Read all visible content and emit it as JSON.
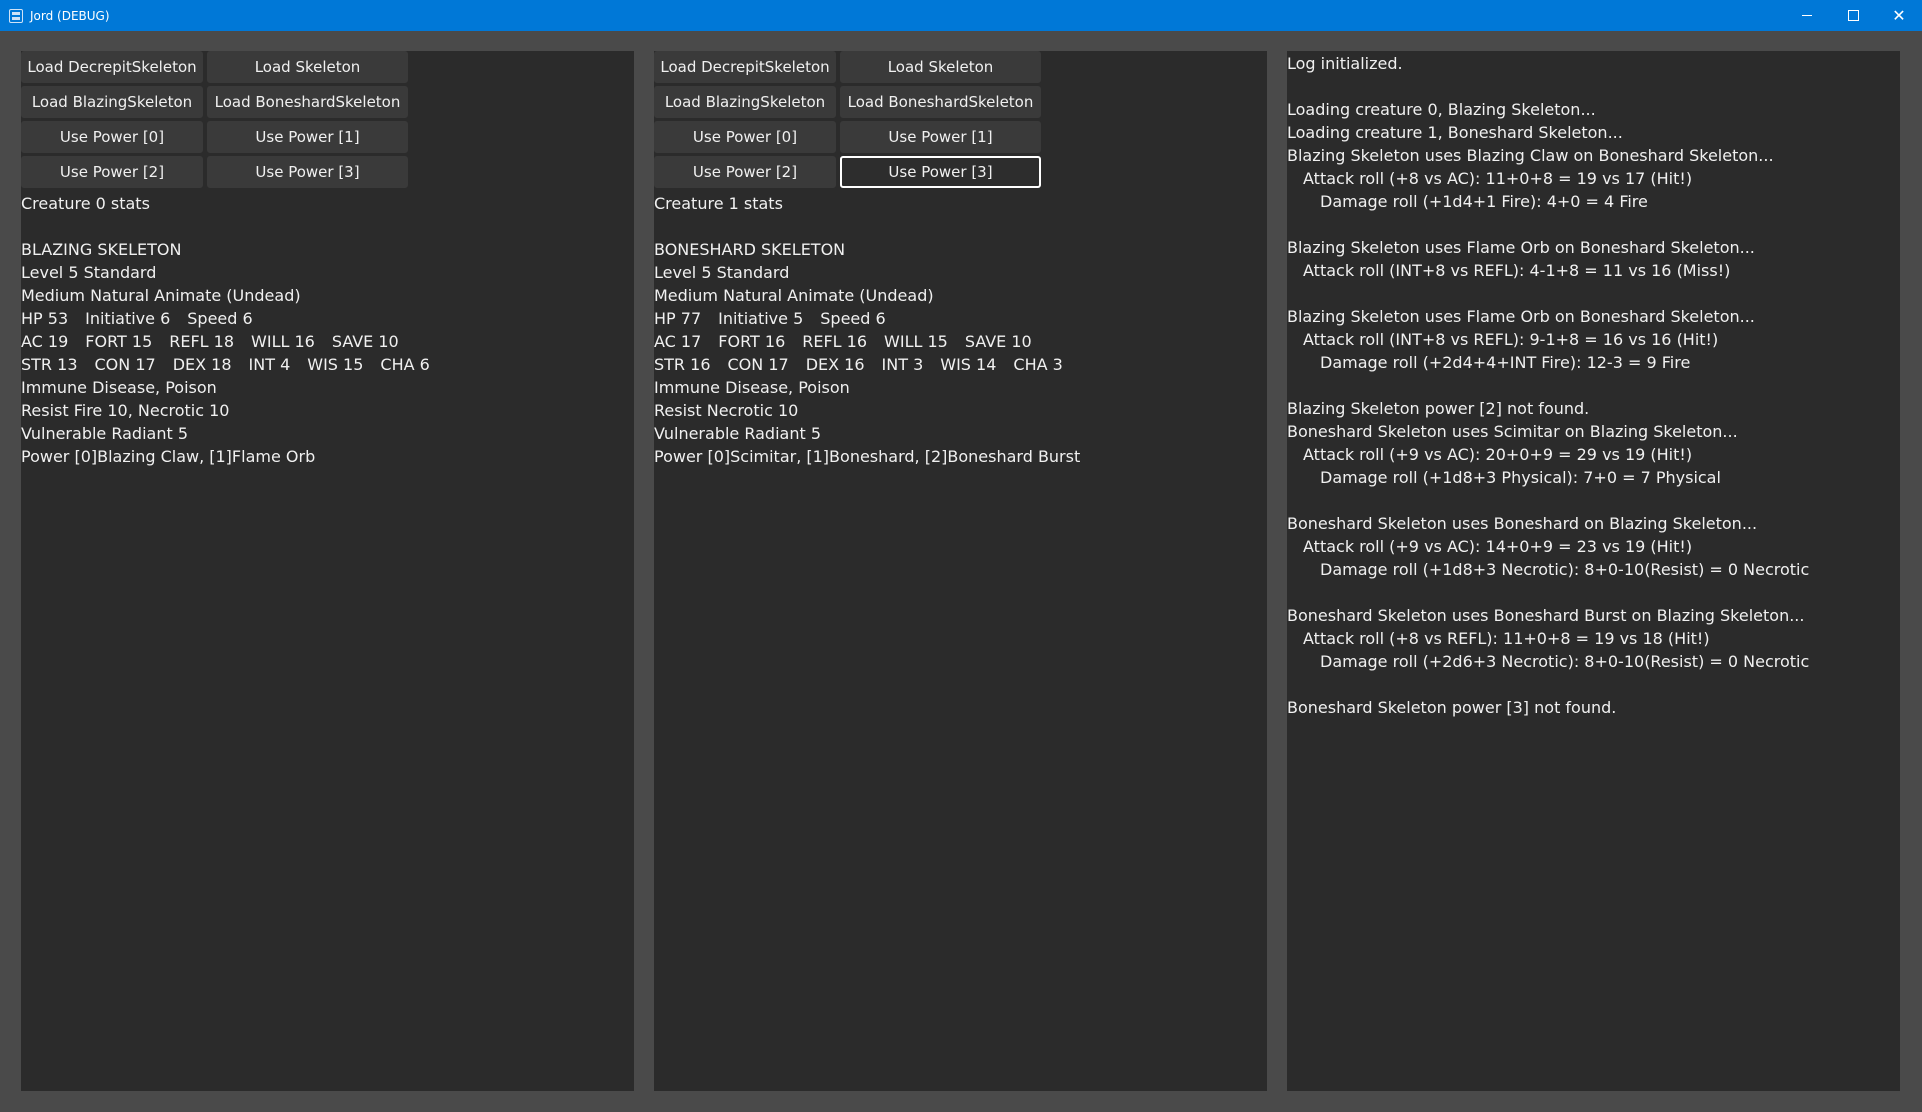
{
  "window": {
    "title": "Jord (DEBUG)",
    "minimize_glyph": "",
    "maximize_glyph": "",
    "close_glyph": "✕"
  },
  "panels": [
    {
      "buttons": {
        "load_decrepit": "Load DecrepitSkeleton",
        "load_skeleton": "Load Skeleton",
        "load_blazing": "Load BlazingSkeleton",
        "load_boneshard": "Load BoneshardSkeleton",
        "use_power_0": "Use Power [0]",
        "use_power_1": "Use Power [1]",
        "use_power_2": "Use Power [2]",
        "use_power_3": "Use Power [3]"
      },
      "stats_heading": "Creature 0 stats",
      "name": "BLAZING SKELETON",
      "level": "Level 5 Standard",
      "type": "Medium Natural Animate (Undead)",
      "vitals": [
        "HP 53",
        "Initiative 6",
        "Speed 6"
      ],
      "defenses": [
        "AC 19",
        "FORT 15",
        "REFL 18",
        "WILL 16",
        "SAVE 10"
      ],
      "abilities": [
        "STR 13",
        "CON 17",
        "DEX 18",
        "INT 4",
        "WIS 15",
        "CHA 6"
      ],
      "immune": "Immune Disease, Poison",
      "resist": "Resist Fire 10, Necrotic 10",
      "vulnerable": "Vulnerable Radiant 5",
      "powers": "Power [0]Blazing Claw, [1]Flame Orb"
    },
    {
      "buttons": {
        "load_decrepit": "Load DecrepitSkeleton",
        "load_skeleton": "Load Skeleton",
        "load_blazing": "Load BlazingSkeleton",
        "load_boneshard": "Load BoneshardSkeleton",
        "use_power_0": "Use Power [0]",
        "use_power_1": "Use Power [1]",
        "use_power_2": "Use Power [2]",
        "use_power_3": "Use Power [3]"
      },
      "stats_heading": "Creature 1 stats",
      "name": "BONESHARD SKELETON",
      "level": "Level 5 Standard",
      "type": "Medium Natural Animate (Undead)",
      "vitals": [
        "HP 77",
        "Initiative 5",
        "Speed 6"
      ],
      "defenses": [
        "AC 17",
        "FORT 16",
        "REFL 16",
        "WILL 15",
        "SAVE 10"
      ],
      "abilities": [
        "STR 16",
        "CON 17",
        "DEX 16",
        "INT 3",
        "WIS 14",
        "CHA 3"
      ],
      "immune": "Immune Disease, Poison",
      "resist": "Resist Necrotic 10",
      "vulnerable": "Vulnerable Radiant 5",
      "powers": "Power [0]Scimitar, [1]Boneshard, [2]Boneshard Burst"
    }
  ],
  "log": [
    {
      "text": "Log initialized.",
      "indent": 0
    },
    {
      "text": "",
      "indent": 0
    },
    {
      "text": "Loading creature 0, Blazing Skeleton...",
      "indent": 0
    },
    {
      "text": "Loading creature 1, Boneshard Skeleton...",
      "indent": 0
    },
    {
      "text": "Blazing Skeleton uses Blazing Claw on Boneshard Skeleton...",
      "indent": 0
    },
    {
      "text": "Attack roll (+8 vs AC): 11+0+8 = 19 vs 17 (Hit!)",
      "indent": 1
    },
    {
      "text": "Damage roll (+1d4+1 Fire): 4+0 = 4 Fire",
      "indent": 2
    },
    {
      "text": "",
      "indent": 0
    },
    {
      "text": "Blazing Skeleton uses Flame Orb on Boneshard Skeleton...",
      "indent": 0
    },
    {
      "text": "Attack roll (INT+8 vs REFL): 4-1+8 = 11 vs 16 (Miss!)",
      "indent": 1
    },
    {
      "text": "",
      "indent": 0
    },
    {
      "text": "Blazing Skeleton uses Flame Orb on Boneshard Skeleton...",
      "indent": 0
    },
    {
      "text": "Attack roll (INT+8 vs REFL): 9-1+8 = 16 vs 16 (Hit!)",
      "indent": 1
    },
    {
      "text": "Damage roll (+2d4+4+INT Fire): 12-3 = 9 Fire",
      "indent": 2
    },
    {
      "text": "",
      "indent": 0
    },
    {
      "text": "Blazing Skeleton power [2] not found.",
      "indent": 0
    },
    {
      "text": "Boneshard Skeleton uses Scimitar on Blazing Skeleton...",
      "indent": 0
    },
    {
      "text": "Attack roll (+9 vs AC): 20+0+9 = 29 vs 19 (Hit!)",
      "indent": 1
    },
    {
      "text": "Damage roll (+1d8+3 Physical): 7+0 = 7 Physical",
      "indent": 2
    },
    {
      "text": "",
      "indent": 0
    },
    {
      "text": "Boneshard Skeleton uses Boneshard on Blazing Skeleton...",
      "indent": 0
    },
    {
      "text": "Attack roll (+9 vs AC): 14+0+9 = 23 vs 19 (Hit!)",
      "indent": 1
    },
    {
      "text": "Damage roll (+1d8+3 Necrotic): 8+0-10(Resist) = 0 Necrotic",
      "indent": 2
    },
    {
      "text": "",
      "indent": 0
    },
    {
      "text": "Boneshard Skeleton uses Boneshard Burst on Blazing Skeleton...",
      "indent": 0
    },
    {
      "text": "Attack roll (+8 vs REFL): 11+0+8 = 19 vs 18 (Hit!)",
      "indent": 1
    },
    {
      "text": "Damage roll (+2d6+3 Necrotic): 8+0-10(Resist) = 0 Necrotic",
      "indent": 2
    },
    {
      "text": "",
      "indent": 0
    },
    {
      "text": "Boneshard Skeleton power [3] not found.",
      "indent": 0
    }
  ]
}
